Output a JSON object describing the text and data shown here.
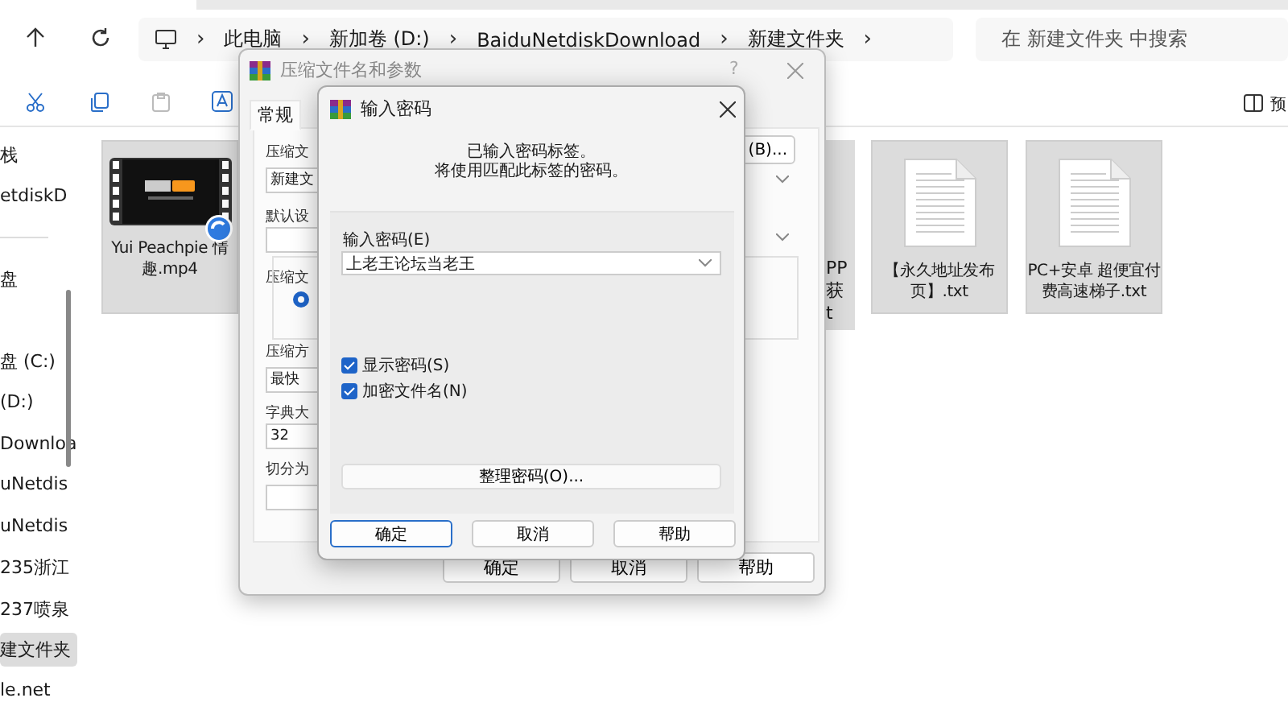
{
  "explorer": {
    "breadcrumb": [
      {
        "label": "此电脑"
      },
      {
        "label": "新加卷 (D:)"
      },
      {
        "label": "BaiduNetdiskDownload"
      },
      {
        "label": "新建文件夹"
      }
    ],
    "separator": "›",
    "search": {
      "placeholder": "在 新建文件夹 中搜索"
    },
    "toolbar_right_label": "预",
    "sidebar": [
      {
        "label": "栈",
        "selected": false
      },
      {
        "label": "etdiskD",
        "selected": false
      },
      {
        "label": "盘",
        "selected": false
      },
      {
        "label": "盘 (C:)",
        "selected": false
      },
      {
        "label": "(D:)",
        "selected": false
      },
      {
        "label": "Downloa",
        "selected": false
      },
      {
        "label": "uNetdis",
        "selected": false
      },
      {
        "label": "uNetdis",
        "selected": false
      },
      {
        "label": "235浙江",
        "selected": false
      },
      {
        "label": "237喷泉",
        "selected": false
      },
      {
        "label": "建文件夹",
        "selected": true
      },
      {
        "label": "le.net",
        "selected": false
      }
    ],
    "files": [
      {
        "kind": "video",
        "name": "Yui Peachpie 情趣.mp4",
        "selected": true
      },
      {
        "kind": "partial",
        "lines": [
          "PP",
          "获",
          "t"
        ],
        "selected": true
      },
      {
        "kind": "text",
        "name": "【永久地址发布页】.txt",
        "selected": true
      },
      {
        "kind": "text",
        "name": "PC+安卓 超便宜付费高速梯子.txt",
        "selected": true
      }
    ]
  },
  "archive_dialog": {
    "title": "压缩文件名和参数",
    "help": "?",
    "tabs": [
      {
        "label": "常规",
        "selected": true
      }
    ],
    "labels": [
      "压缩文",
      "默认设",
      "压缩文",
      "压缩方",
      "字典大",
      "切分为"
    ],
    "fields": [
      {
        "kind": "text",
        "value": "新建文"
      },
      {
        "kind": "empty"
      },
      {
        "kind": "text",
        "value": "最快"
      },
      {
        "kind": "text",
        "value": "32"
      },
      {
        "kind": "empty"
      }
    ],
    "radio_checked": true,
    "browse_button": "(B)...",
    "buttons": [
      "确定",
      "取消",
      "帮助"
    ]
  },
  "password_dialog": {
    "title": "输入密码",
    "message": [
      "已输入密码标签。",
      "将使用匹配此标签的密码。"
    ],
    "password_label": "输入密码(E)",
    "password_value": "上老王论坛当老王",
    "options": [
      {
        "label": "显示密码(S)",
        "checked": true
      },
      {
        "label": "加密文件名(N)",
        "checked": true
      }
    ],
    "organize_button": "整理密码(O)...",
    "buttons": [
      {
        "label": "确定",
        "selected": true
      },
      {
        "label": "取消",
        "selected": false
      },
      {
        "label": "帮助",
        "selected": false
      }
    ]
  }
}
